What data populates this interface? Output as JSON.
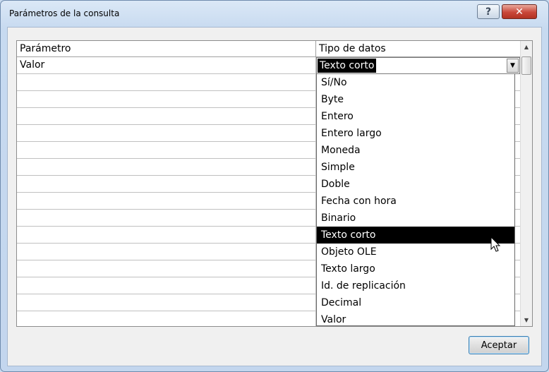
{
  "window": {
    "title": "Parámetros de la consulta",
    "help_label": "?",
    "close_label": "✕"
  },
  "grid": {
    "headers": [
      "Parámetro",
      "Tipo de datos"
    ],
    "first_row": {
      "parameter": "Valor",
      "type": "Texto corto"
    }
  },
  "dropdown": {
    "selected": "Texto corto",
    "options": [
      "Sí/No",
      "Byte",
      "Entero",
      "Entero largo",
      "Moneda",
      "Simple",
      "Doble",
      "Fecha con hora",
      "Binario",
      "Texto corto",
      "Objeto OLE",
      "Texto largo",
      "Id. de replicación",
      "Decimal",
      "Valor"
    ]
  },
  "buttons": {
    "ok_label": "Aceptar"
  },
  "colors": {
    "selection": "#000000",
    "window_frame": "#c3d6ee",
    "close_button": "#c9473a"
  },
  "icons": {
    "help": "question-icon",
    "close": "close-icon",
    "combo": "chevron-down-icon"
  }
}
